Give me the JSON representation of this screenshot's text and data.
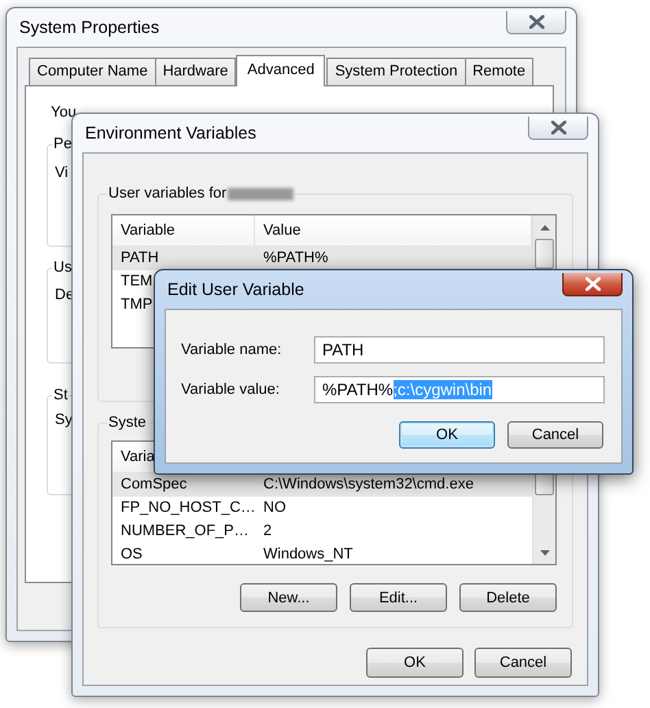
{
  "system_properties": {
    "title": "System Properties",
    "active": false,
    "tabs": [
      {
        "label": "Computer Name",
        "selected": false
      },
      {
        "label": "Hardware",
        "selected": false
      },
      {
        "label": "Advanced",
        "selected": true
      },
      {
        "label": "System Protection",
        "selected": false
      },
      {
        "label": "Remote",
        "selected": false
      }
    ],
    "notice": "You",
    "groups": [
      {
        "label": "Pe",
        "text": "Vi"
      },
      {
        "label": "Us",
        "text": "De"
      },
      {
        "label": "St",
        "text": "Sy"
      }
    ]
  },
  "environment_variables": {
    "title": "Environment Variables",
    "active": false,
    "user_variables": {
      "label": "User variables for",
      "name_redacted": true,
      "columns": [
        "Variable",
        "Value"
      ],
      "rows": [
        {
          "variable": "PATH",
          "value": "%PATH%",
          "selected": true
        },
        {
          "variable": "TEM",
          "selected": false
        },
        {
          "variable": "TMP",
          "selected": false
        }
      ]
    },
    "system_variables": {
      "label": "Syste",
      "columns": [
        "Varia"
      ],
      "rows": [
        {
          "variable": "ComSpec",
          "value": "C:\\Windows\\system32\\cmd.exe",
          "selected": true
        },
        {
          "variable": "FP_NO_HOST_C…",
          "value": "NO",
          "selected": false
        },
        {
          "variable": "NUMBER_OF_P…",
          "value": "2",
          "selected": false
        },
        {
          "variable": "OS",
          "value": "Windows_NT",
          "selected": false
        }
      ],
      "buttons": [
        "New...",
        "Edit...",
        "Delete"
      ]
    },
    "buttons": [
      "OK",
      "Cancel"
    ]
  },
  "edit_user_variable": {
    "title": "Edit User Variable",
    "active": true,
    "fields": [
      {
        "label": "Variable name:",
        "value_parts": [
          {
            "text": "PATH",
            "selected": false
          }
        ]
      },
      {
        "label": "Variable value:",
        "value_parts": [
          {
            "text": "%PATH%",
            "selected": false
          },
          {
            "text": ";c:\\cygwin\\bin",
            "selected": true
          }
        ]
      }
    ],
    "buttons": [
      {
        "label": "OK",
        "focused": true
      },
      {
        "label": "Cancel",
        "focused": false
      }
    ]
  }
}
